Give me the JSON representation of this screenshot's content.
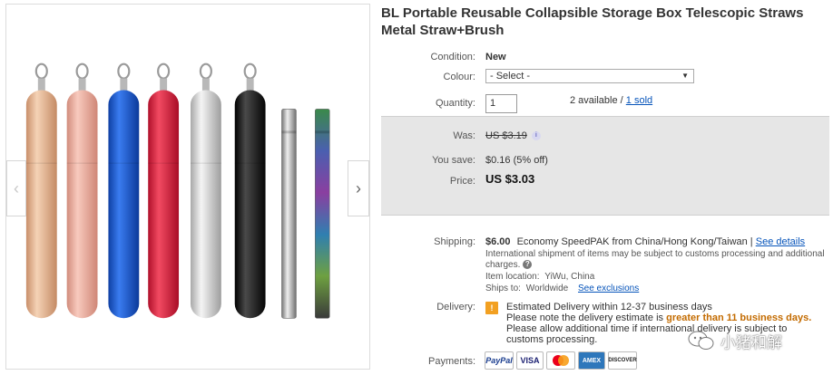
{
  "product": {
    "title": "BL Portable Reusable Collapsible Storage Box Telescopic Straws Metal Straw+Brush"
  },
  "gallery": {
    "prev_icon": "chevron-left-icon",
    "next_icon": "chevron-right-icon",
    "item_colors": [
      "#e8b994",
      "#eeb3a4",
      "#1c5fd6",
      "#e0243f",
      "#d4d4d4",
      "#1a1a1a",
      "#bcbcbc",
      "rainbow"
    ]
  },
  "condition": {
    "label": "Condition:",
    "value": "New"
  },
  "colour": {
    "label": "Colour:",
    "selected": "- Select -"
  },
  "quantity": {
    "label": "Quantity:",
    "value": "1",
    "available": "2 available /",
    "sold": "1 sold"
  },
  "pricing": {
    "was_label": "Was:",
    "was_value": "US $3.19",
    "save_label": "You save:",
    "save_value": "$0.16 (5% off)",
    "price_label": "Price:",
    "price_value": "US $3.03"
  },
  "shipping": {
    "label": "Shipping:",
    "cost": "$6.00",
    "service": "Economy SpeedPAK from China/Hong Kong/Taiwan |",
    "details_link": "See details",
    "note_line1": "International shipment of items may be subject to customs processing and additional",
    "note_line2": "charges.",
    "location_label": "Item location:",
    "location_value": "YiWu, China",
    "ships_to_label": "Ships to:",
    "ships_to_value": "Worldwide",
    "exclusions_link": "See exclusions"
  },
  "delivery": {
    "label": "Delivery:",
    "estimate": "Estimated Delivery within 12-37 business days",
    "note_prefix": "Please note the delivery estimate is",
    "note_highlight": "greater than 11 business days.",
    "note_line3": "Please allow additional time if international delivery is subject to",
    "note_line4": "customs processing."
  },
  "payments": {
    "label": "Payments:",
    "methods": [
      "PayPal",
      "VISA",
      "MasterCard",
      "AMEX",
      "DISCOVER"
    ]
  },
  "watermark": {
    "text": "小猪和解"
  }
}
